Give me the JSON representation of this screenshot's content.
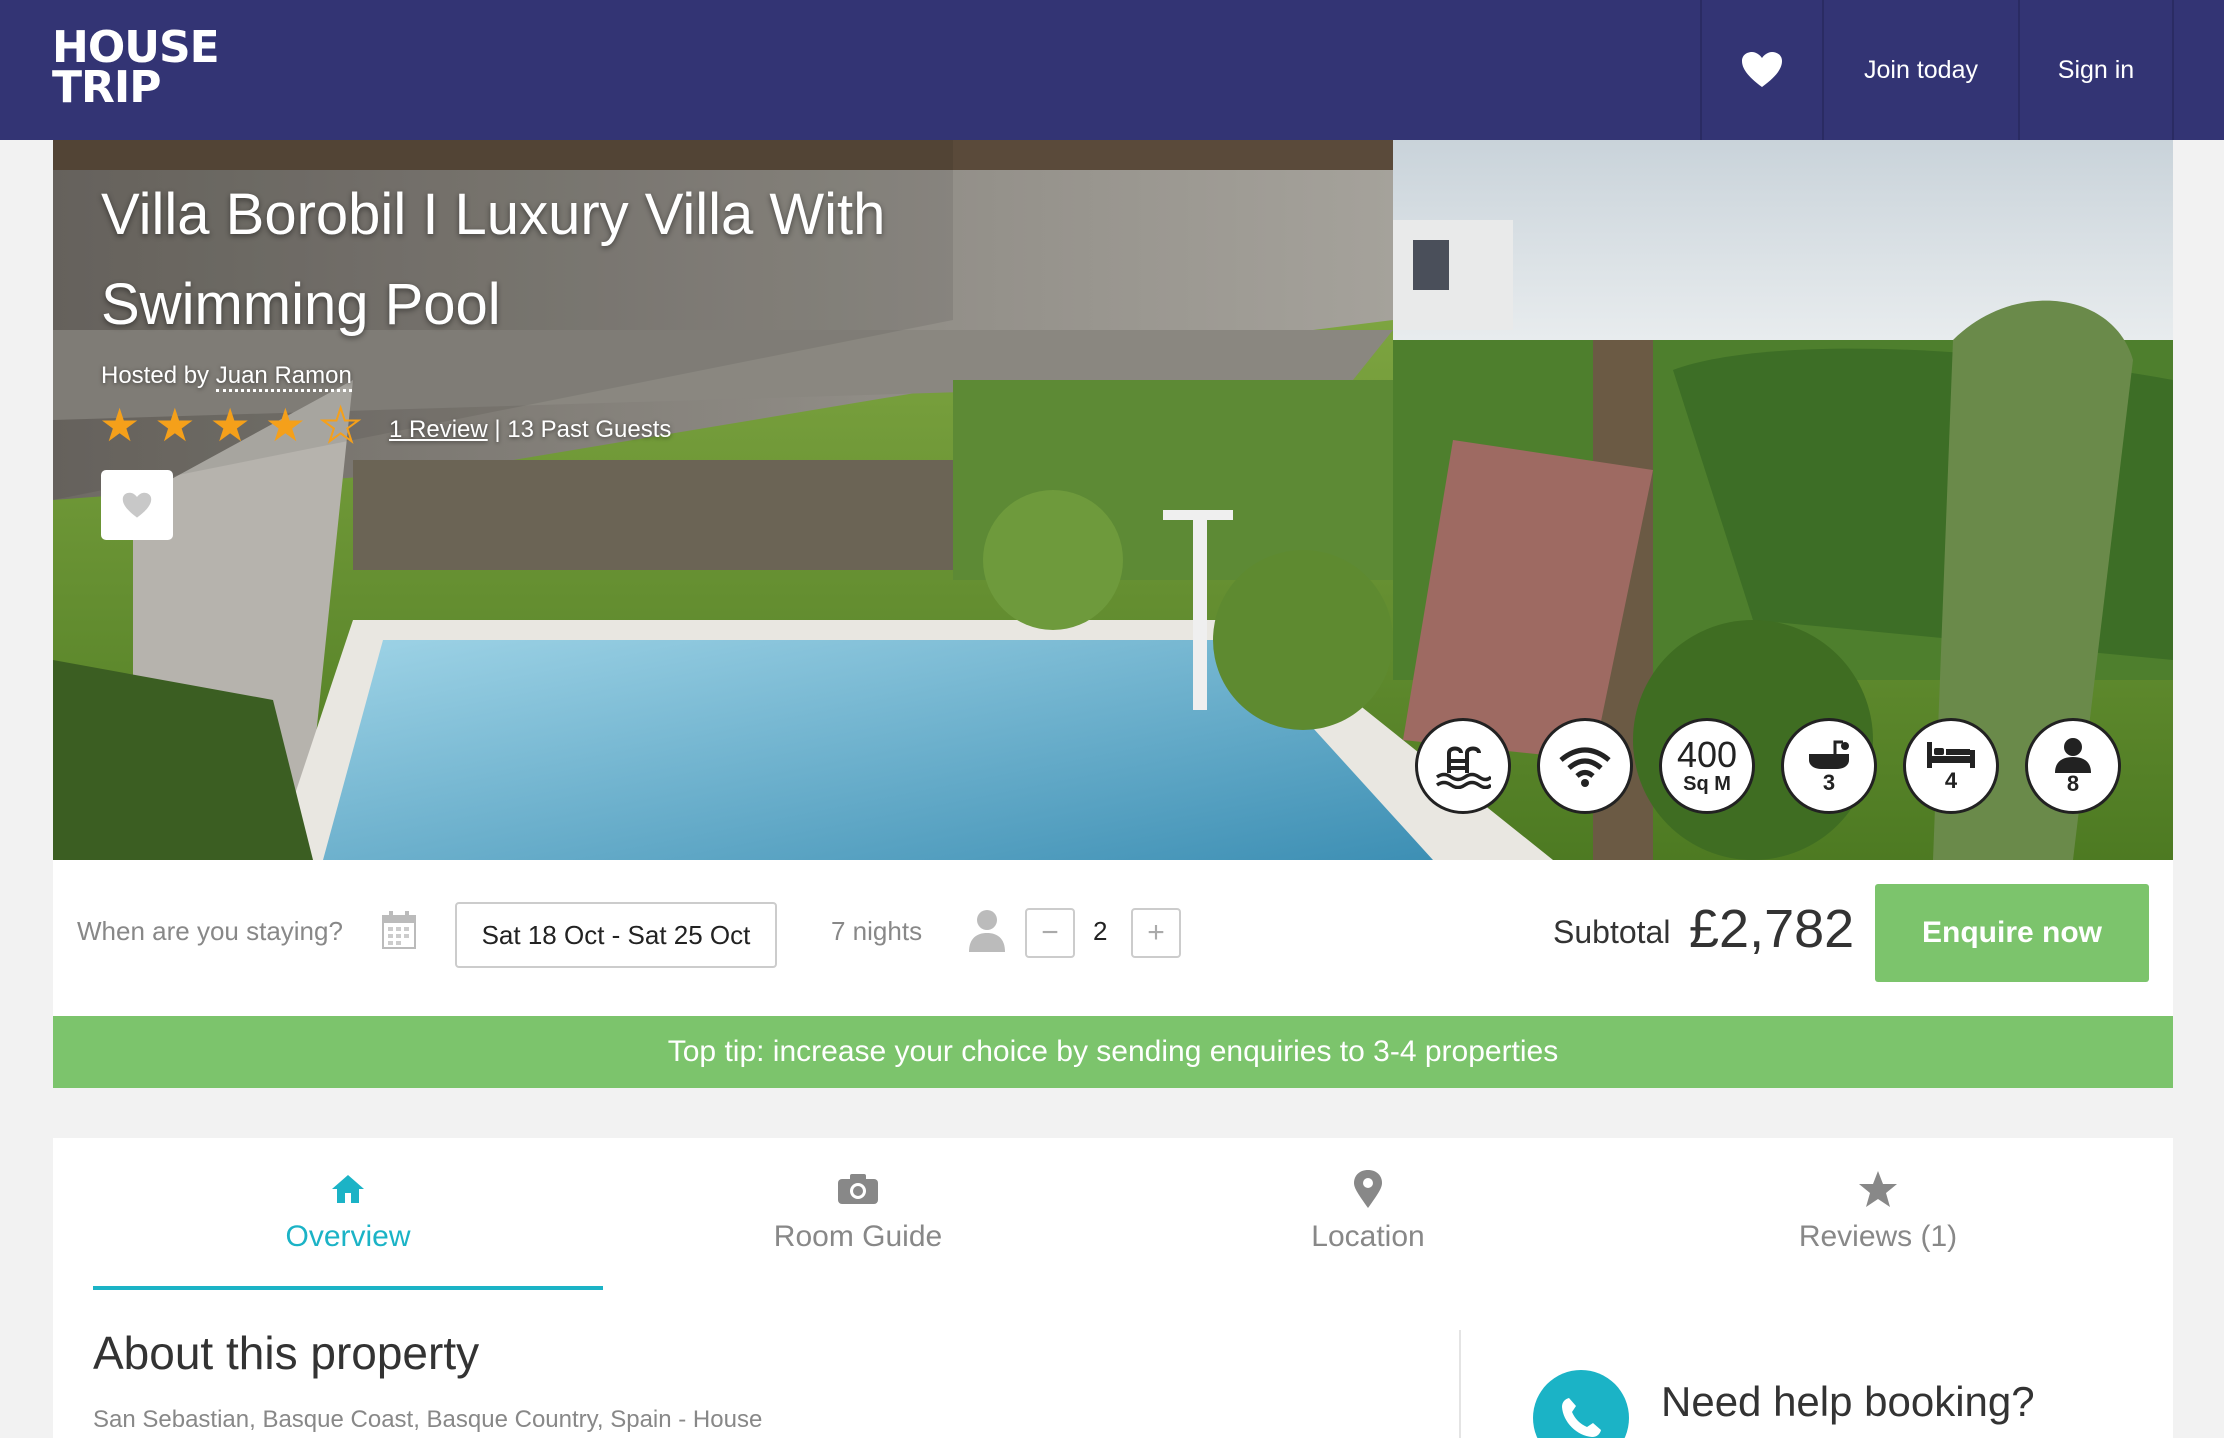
{
  "header": {
    "logo_line1": "HOUSE",
    "logo_line2": "TRIP",
    "wishlist_icon": "heart-icon",
    "join_label": "Join today",
    "signin_label": "Sign in"
  },
  "listing": {
    "title": "Villa Borobil I Luxury Villa With Swimming Pool",
    "hosted_prefix": "Hosted by",
    "host_name": "Juan Ramon",
    "rating": 4,
    "rating_max": 5,
    "review_link": "1 Review",
    "past_guests": "| 13 Past Guests"
  },
  "amenities": [
    {
      "icon": "pool-icon",
      "label": ""
    },
    {
      "icon": "wifi-icon",
      "label": ""
    },
    {
      "icon": "area",
      "value": "400",
      "unit": "Sq M"
    },
    {
      "icon": "bathroom-icon",
      "label": "3"
    },
    {
      "icon": "bedroom-icon",
      "label": "4"
    },
    {
      "icon": "guests-icon",
      "label": "8"
    }
  ],
  "booking": {
    "staying_label": "When are you staying?",
    "date_range": "Sat 18 Oct - Sat 25 Oct",
    "nights": "7 nights",
    "guests": "2",
    "minus": "−",
    "plus": "+",
    "subtotal_label": "Subtotal",
    "subtotal_value": "£2,782",
    "enquire_label": "Enquire now"
  },
  "tip": "Top tip: increase your choice by sending enquiries to 3-4 properties",
  "tabs": [
    {
      "label": "Overview",
      "icon": "home-icon",
      "active": true
    },
    {
      "label": "Room Guide",
      "icon": "camera-icon",
      "active": false
    },
    {
      "label": "Location",
      "icon": "map-pin-icon",
      "active": false
    },
    {
      "label": "Reviews (1)",
      "icon": "star-icon",
      "active": false
    }
  ],
  "about": {
    "title": "About this property",
    "location": "San Sebastian, Basque Coast, Basque Country, Spain - House"
  },
  "help": {
    "title": "Need help booking?",
    "icon": "phone-icon"
  },
  "colors": {
    "header_bg": "#333474",
    "accent_green": "#7cc46c",
    "accent_teal": "#1bb3c6",
    "star": "#f5a01a"
  }
}
